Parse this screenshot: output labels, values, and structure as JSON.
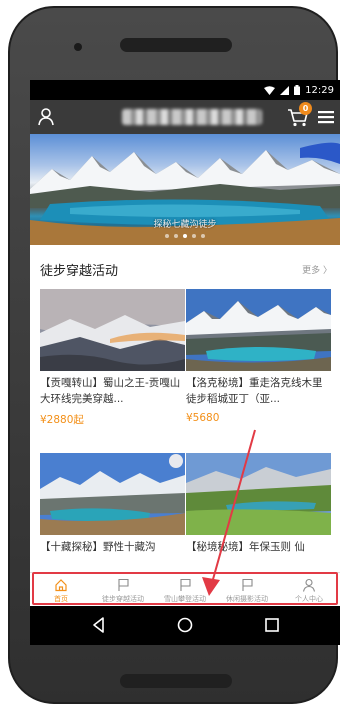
{
  "status_bar": {
    "time": "12:29"
  },
  "app_bar": {
    "title": "······ ····",
    "cart_count": "0"
  },
  "banner": {
    "caption": "探秘七藏沟徒步",
    "dot_count": 5,
    "active_dot": 2
  },
  "section": {
    "title": "徒步穿越活动",
    "more": "更多 〉"
  },
  "cards": [
    {
      "title": "【贡嘎转山】蜀山之王-贡嘎山大环线完美穿越...",
      "price": "¥2880起"
    },
    {
      "title": "【洛克秘境】重走洛克线木里徒步稻城亚丁（亚...",
      "price": "¥5680"
    },
    {
      "title": "【十藏探秘】野性十藏沟"
    },
    {
      "title": "【秘境秘境】年保玉则 仙"
    }
  ],
  "tabs": [
    {
      "label": "首页",
      "icon": "home-icon",
      "active": true
    },
    {
      "label": "徒步穿越活动",
      "icon": "flag-icon"
    },
    {
      "label": "雪山攀登活动",
      "icon": "flag-icon"
    },
    {
      "label": "休闲摄影活动",
      "icon": "flag-icon"
    },
    {
      "label": "个人中心",
      "icon": "person-icon"
    }
  ],
  "colors": {
    "accent": "#f39019",
    "annotation": "#e23a45",
    "app_bar": "#3a3a3a"
  }
}
